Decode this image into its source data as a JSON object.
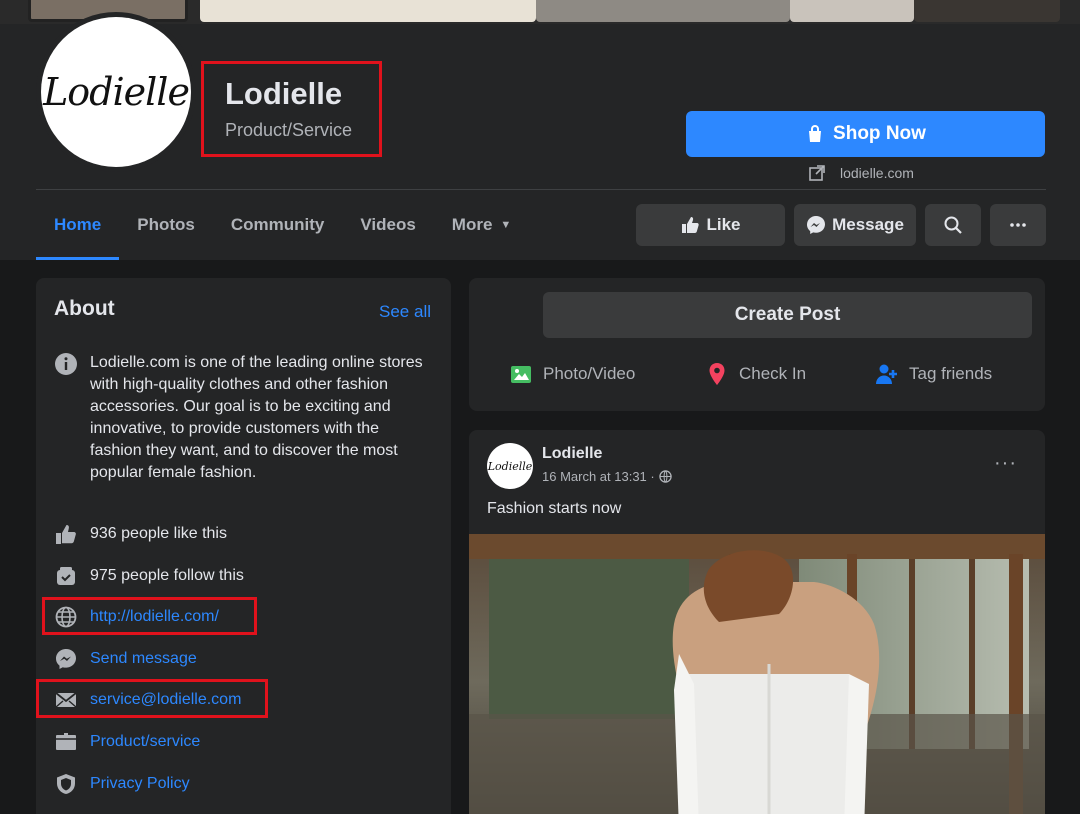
{
  "page": {
    "name": "Lodielle",
    "category": "Product/Service",
    "logo_text": "Lodielle"
  },
  "header": {
    "shop_button": "Shop Now",
    "website_display": "lodielle.com"
  },
  "tabs": [
    "Home",
    "Photos",
    "Community",
    "Videos",
    "More"
  ],
  "actions": {
    "like": "Like",
    "message": "Message"
  },
  "about": {
    "title": "About",
    "see_all": "See all",
    "description": "Lodielle.com is one of the leading online stores with high-quality clothes and other fashion accessories. Our goal is to be exciting and innovative, to provide customers with the fashion they want, and to discover the most popular female fashion.",
    "likes": "936 people like this",
    "follows": "975 people follow this",
    "website": "http://lodielle.com/",
    "send_message": "Send message",
    "email": "service@lodielle.com",
    "category": "Product/service",
    "privacy": "Privacy Policy"
  },
  "create_post": {
    "button": "Create Post",
    "photo_video": "Photo/Video",
    "check_in": "Check In",
    "tag_friends": "Tag friends"
  },
  "post": {
    "author": "Lodielle",
    "avatar_text": "Lodielle",
    "time": "16 March at 13:31 ·",
    "text": "Fashion starts now",
    "more": "···"
  },
  "colors": {
    "accent": "#2d88ff",
    "highlight": "#e0121c",
    "background": "#18191a",
    "card": "#242526"
  },
  "icons": [
    "info-icon",
    "like-icon",
    "follow-icon",
    "globe-icon",
    "messenger-icon",
    "envelope-icon",
    "briefcase-icon",
    "shield-icon",
    "search-icon",
    "shopping-bag-icon",
    "external-link-icon"
  ]
}
